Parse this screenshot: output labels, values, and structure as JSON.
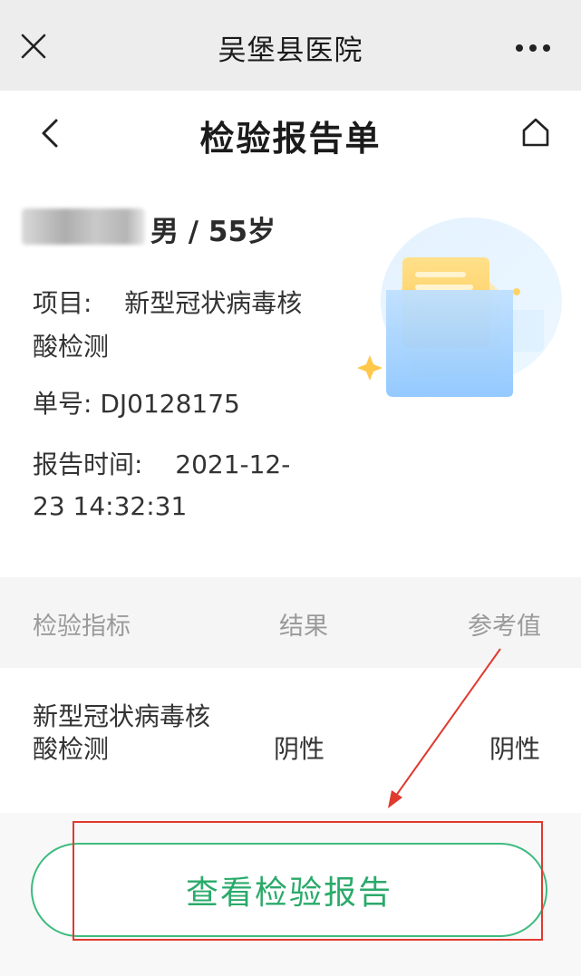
{
  "wechat_bar": {
    "title": "吴堡县医院"
  },
  "nav": {
    "title": "检验报告单"
  },
  "patient": {
    "gender_age": "男 / 55岁"
  },
  "report": {
    "item_label": "项目:",
    "item_value_line1": "新型冠状病毒核",
    "item_value_line2": "酸检测",
    "number_label": "单号:",
    "number_value": "DJ0128175",
    "time_label": "报告时间:",
    "time_value_line1": "2021-12-",
    "time_value_line2": "23 14:32:31"
  },
  "table": {
    "headers": [
      "检验指标",
      "结果",
      "参考值"
    ],
    "rows": [
      {
        "indicator_line1": "新型冠状病毒核",
        "indicator_line2": "酸检测",
        "result": "阴性",
        "reference": "阴性"
      }
    ]
  },
  "actions": {
    "view_report_label": "查看检验报告"
  },
  "colors": {
    "accent_green": "#2aaa6a",
    "annotation_red": "#e03a2f",
    "topbar_bg": "#ededed"
  },
  "icons": [
    "close-icon",
    "more-icon",
    "back-icon",
    "home-icon",
    "report-illustration"
  ]
}
